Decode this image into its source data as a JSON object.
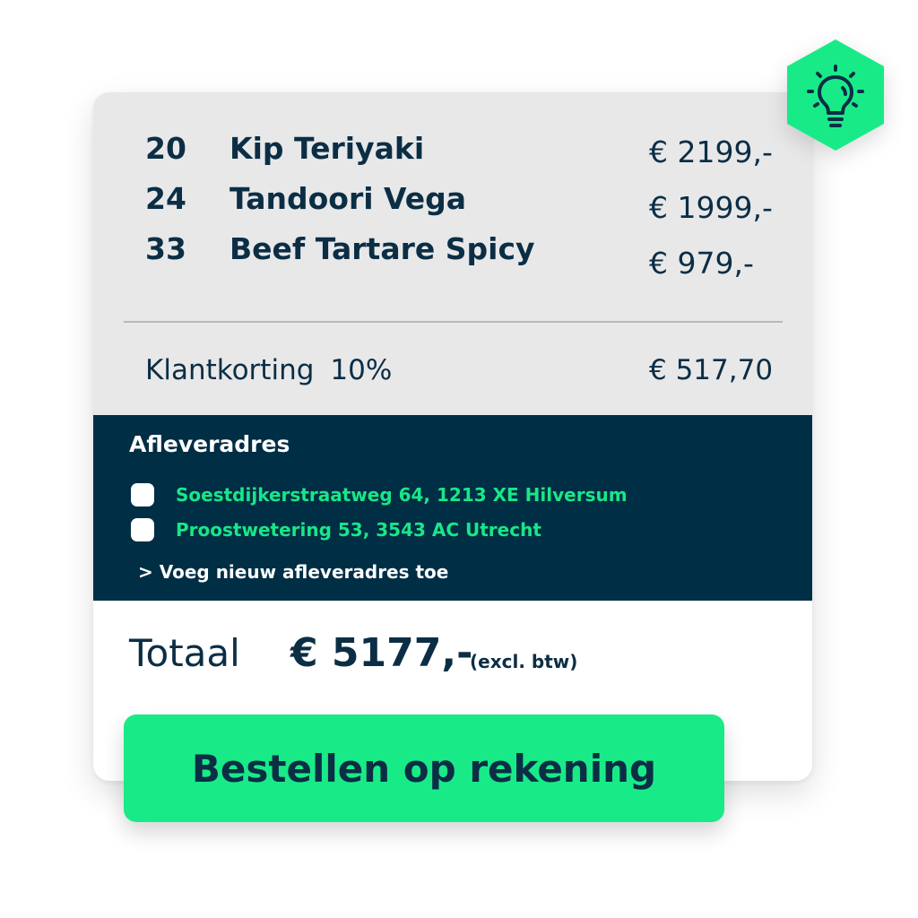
{
  "order": {
    "items": [
      {
        "qty": "20",
        "name": "Kip Teriyaki",
        "price": "€ 2199,-"
      },
      {
        "qty": "24",
        "name": "Tandoori Vega",
        "price": "€ 1999,-"
      },
      {
        "qty": "33",
        "name": "Beef Tartare Spicy",
        "price": "€ 979,-"
      }
    ],
    "discount": {
      "label": "Klantkorting",
      "percent": "10%",
      "value": "€ 517,70"
    }
  },
  "delivery": {
    "title": "Afleveradres",
    "options": [
      {
        "address": "Soestdijkerstraatweg 64, 1213 XE Hilversum",
        "checked": false
      },
      {
        "address": "Proostwetering 53, 3543 AC Utrecht",
        "checked": false
      }
    ],
    "add_link": "> Voeg nieuw afleveradres toe"
  },
  "total": {
    "label": "Totaal",
    "amount": "€ 5177,-",
    "note": "(excl. btw)"
  },
  "order_button": {
    "label": "Bestellen op rekening"
  },
  "badge": {
    "icon": "lightbulb-icon"
  },
  "colors": {
    "navy": "#0b2e45",
    "dark_panel": "#002e45",
    "accent_green": "#19ea88",
    "light_panel": "#e8e8e9"
  }
}
